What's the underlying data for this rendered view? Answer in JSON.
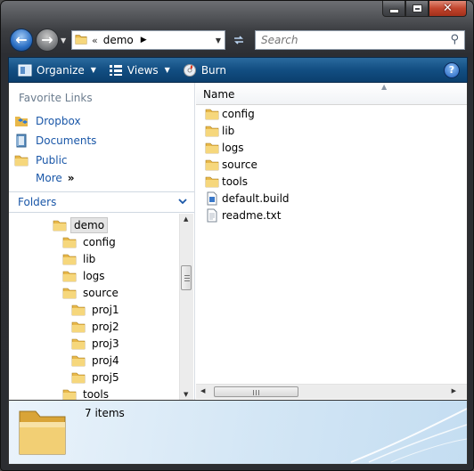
{
  "window": {
    "caption": {
      "minimize": "minimize",
      "maximize": "maximize",
      "close": "✕"
    }
  },
  "address_bar": {
    "history_symbol": "«",
    "crumbs": [
      "demo"
    ],
    "dropdown_symbol": "▼"
  },
  "search": {
    "placeholder": "Search"
  },
  "toolbar": {
    "organize": "Organize",
    "views": "Views",
    "burn": "Burn",
    "help": "?"
  },
  "navigation_pane": {
    "favorite_links_title": "Favorite Links",
    "favorites": [
      {
        "label": "Dropbox",
        "icon": "dropbox-icon"
      },
      {
        "label": "Documents",
        "icon": "documents-icon"
      },
      {
        "label": "Public",
        "icon": "folder-icon"
      }
    ],
    "more": "More",
    "more_chevron": "»",
    "folders_title": "Folders",
    "folders_chevron": "⌄",
    "tree": [
      {
        "label": "demo",
        "selected": true
      },
      {
        "label": "config"
      },
      {
        "label": "lib"
      },
      {
        "label": "logs"
      },
      {
        "label": "source"
      },
      {
        "label": "proj1"
      },
      {
        "label": "proj2"
      },
      {
        "label": "proj3"
      },
      {
        "label": "proj4"
      },
      {
        "label": "proj5"
      },
      {
        "label": "tools"
      }
    ]
  },
  "file_list": {
    "column_name": "Name",
    "items": [
      {
        "label": "config",
        "type": "folder"
      },
      {
        "label": "lib",
        "type": "folder"
      },
      {
        "label": "logs",
        "type": "folder"
      },
      {
        "label": "source",
        "type": "folder"
      },
      {
        "label": "tools",
        "type": "folder"
      },
      {
        "label": "default.build",
        "type": "build-file"
      },
      {
        "label": "readme.txt",
        "type": "text-file"
      }
    ]
  },
  "details_pane": {
    "item_count": "7 items"
  },
  "colors": {
    "link": "#1a57a8",
    "toolbar": "#124e82",
    "folder": "#e8b84a"
  }
}
